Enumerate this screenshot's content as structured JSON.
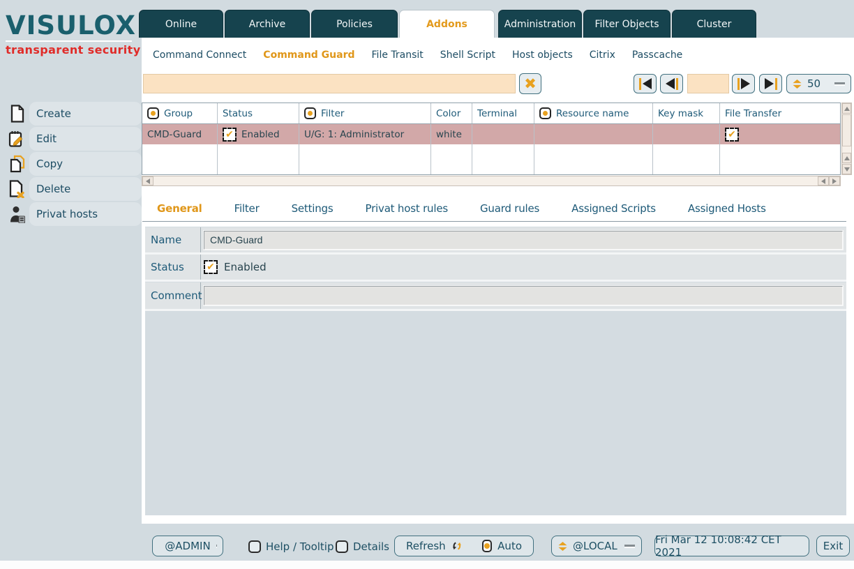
{
  "logo": {
    "title": "VISULOX",
    "tagline": "transparent security"
  },
  "nav": {
    "tabs": [
      "Online",
      "Archive",
      "Policies",
      "Addons",
      "Administration",
      "Filter Objects",
      "Cluster"
    ],
    "active_tab": "Addons"
  },
  "subnav": {
    "items": [
      "Command Connect",
      "Command Guard",
      "File Transit",
      "Shell Script",
      "Host objects",
      "Citrix",
      "Passcache"
    ],
    "active_item": "Command Guard"
  },
  "toolbar": {
    "search_value": "",
    "page_value": "",
    "page_size": "50"
  },
  "table": {
    "columns": [
      {
        "label": "Group",
        "has_icon": true
      },
      {
        "label": "Status",
        "has_icon": false
      },
      {
        "label": "Filter",
        "has_icon": true
      },
      {
        "label": "Color",
        "has_icon": false
      },
      {
        "label": "Terminal",
        "has_icon": false
      },
      {
        "label": "Resource name",
        "has_icon": true
      },
      {
        "label": "Key mask",
        "has_icon": false
      },
      {
        "label": "File Transfer",
        "has_icon": false
      }
    ],
    "row": {
      "group": "CMD-Guard",
      "status": "Enabled",
      "filter": "U/G: 1: Administrator",
      "color": "white",
      "terminal": "",
      "resource_name": "",
      "key_mask": "",
      "file_transfer": "checked"
    }
  },
  "sidebar": {
    "items": [
      "Create",
      "Edit",
      "Copy",
      "Delete",
      "Privat hosts"
    ]
  },
  "detail": {
    "tabs": [
      "General",
      "Filter",
      "Settings",
      "Privat host rules",
      "Guard rules",
      "Assigned Scripts",
      "Assigned Hosts"
    ],
    "active_tab": "General",
    "fields": {
      "name": {
        "label": "Name",
        "value": "CMD-Guard"
      },
      "status": {
        "label": "Status",
        "value": "Enabled"
      },
      "comment": {
        "label": "Comment",
        "value": ""
      }
    }
  },
  "footer": {
    "user_scope": "@ADMIN",
    "help_label": "Help / Tooltip",
    "details_label": "Details",
    "refresh_label": "Refresh",
    "auto_label": "Auto",
    "host_scope": "@LOCAL",
    "datetime": "Fri Mar 12 10:08:42 CET 2021",
    "exit_label": "Exit"
  },
  "icons": {
    "check": "✔",
    "close": "✖"
  },
  "colors": {
    "accent_orange": "#e39a1c",
    "nav_teal": "#16434e",
    "text_teal": "#1e5a78",
    "row_pink": "#d2a8a8",
    "search_peach": "#fbe2c2",
    "logo_teal": "#1a5f6d",
    "logo_red": "#e02b28"
  }
}
